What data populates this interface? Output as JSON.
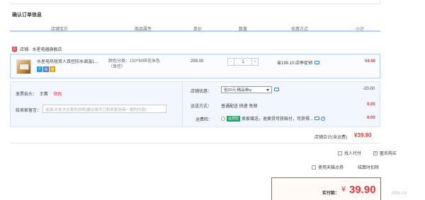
{
  "page": {
    "title": "确认订单信息"
  },
  "table_headers": [
    "店铺宝贝",
    "商品属性",
    "单价",
    "数量",
    "优惠方式",
    "小计"
  ],
  "shop": {
    "label": "店铺:",
    "name": "水星电器旗舰店"
  },
  "item": {
    "name": "水星电热毯双人双控防水调温1...",
    "tags": [
      "7",
      "保",
      "赔"
    ],
    "attr": "颜色分类：150*80碎花米色（单控）",
    "price": "259.00",
    "quantity": "1",
    "minus": "-",
    "plus": "+",
    "promo": "省199.10:店季促销",
    "subtotal": "59.90"
  },
  "invoice": {
    "label": "发票抬头：",
    "value": "王菁",
    "edit": "修改"
  },
  "remark": {
    "label": "给卖家留言：",
    "placeholder": "选填:对本次交易的说明(建议填写已和卖家协商一致的内容)"
  },
  "shop_discount": {
    "label": "店铺优惠：",
    "selected": "省20元:精品券ty",
    "value": "-20.00"
  },
  "shipping": {
    "label": "运送方式：",
    "value": "普通配送 快递 免邮",
    "price": "0.00"
  },
  "insurance": {
    "label": "运费险：",
    "tag": "运费险",
    "text": "卖家赠送，退换货可获赔付，可获得...",
    "price": "0.00"
  },
  "shop_total": {
    "label": "店铺合计(含运费)",
    "value": "¥39.90"
  },
  "options": {
    "proxy_pay": "找人代付",
    "anonymous": "匿名购买",
    "tmall_points": "使用天猫点券",
    "tmall_points_note": "结算时扣除"
  },
  "pay": {
    "label": "实付款：",
    "currency": "¥",
    "amount": "39.90"
  },
  "watermark": "itdw.cn",
  "colors": {
    "accent": "#e4393c",
    "header_rule": "#b2d1ff",
    "pay_border": "#ff4200",
    "insurance_green": "#1aa260"
  }
}
